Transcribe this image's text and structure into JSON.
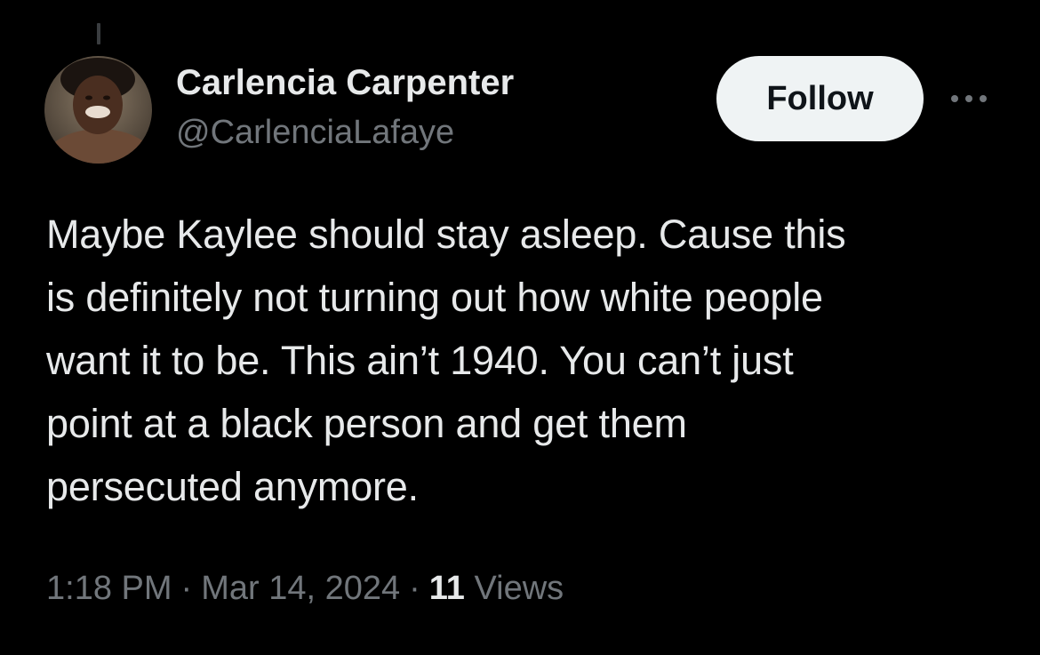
{
  "author": {
    "display_name": "Carlencia Carpenter",
    "handle": "@CarlenciaLafaye",
    "avatar_icon": "profile-photo-avatar"
  },
  "actions": {
    "follow_label": "Follow",
    "more_icon": "more-horizontal-icon"
  },
  "tweet": {
    "text_lines": [
      "Maybe Kaylee should stay asleep. Cause this",
      "is definitely not turning out how white people",
      "want it to be. This ain’t 1940. You can’t just",
      "point at a black person and get them",
      "persecuted anymore."
    ]
  },
  "meta": {
    "time": "1:18 PM",
    "separator": "·",
    "date": "Mar 14, 2024",
    "views_count": "11",
    "views_label": "Views"
  },
  "colors": {
    "background": "#000000",
    "primary_text": "#e7e9ea",
    "secondary_text": "#71767b",
    "follow_bg": "#eff3f4",
    "follow_text": "#0f1419"
  }
}
